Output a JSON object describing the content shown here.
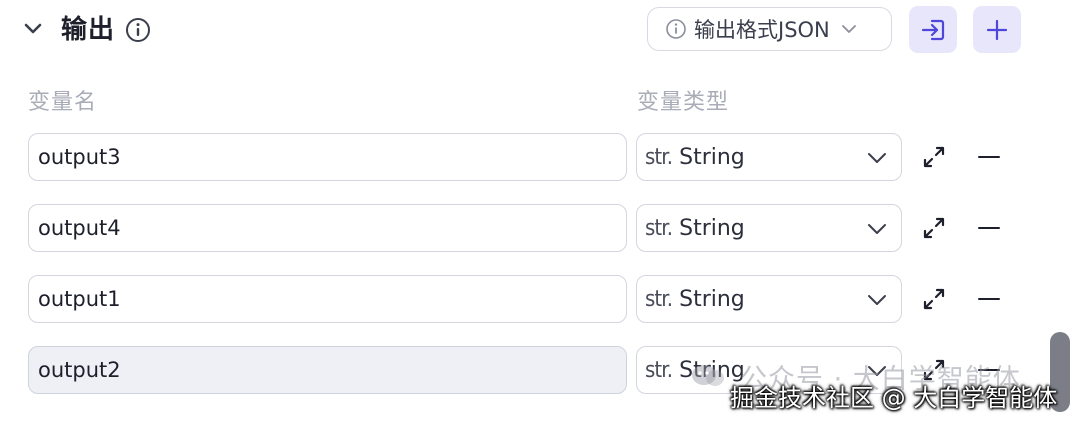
{
  "section": {
    "title": "输出",
    "icons": {
      "collapse": "chevron-down-icon",
      "info": "info-circle-icon"
    }
  },
  "format_select": {
    "label": "输出格式JSON",
    "icons": {
      "info": "info-circle-icon",
      "dropdown": "chevron-down-icon"
    }
  },
  "toolbar": {
    "import_icon": "import-icon",
    "add_icon": "plus-icon"
  },
  "columns": {
    "name_header": "变量名",
    "type_header": "变量类型"
  },
  "variables": [
    {
      "name": "output3",
      "type_prefix": "str.",
      "type": "String",
      "active": false
    },
    {
      "name": "output4",
      "type_prefix": "str.",
      "type": "String",
      "active": false
    },
    {
      "name": "output1",
      "type_prefix": "str.",
      "type": "String",
      "active": false
    },
    {
      "name": "output2",
      "type_prefix": "str.",
      "type": "String",
      "active": true
    }
  ],
  "row_icons": {
    "expand": "expand-arrows-icon",
    "remove": "minus-icon",
    "dropdown": "chevron-down-icon"
  },
  "watermark": {
    "faint": "公众号 · 大白学智能体",
    "main": "掘金技术社区 @ 大白学智能体"
  },
  "colors": {
    "accent": "#4e47d9",
    "accent_bg": "#e7e6fb",
    "muted_text": "#a9acb7",
    "border": "#d3d6df"
  }
}
